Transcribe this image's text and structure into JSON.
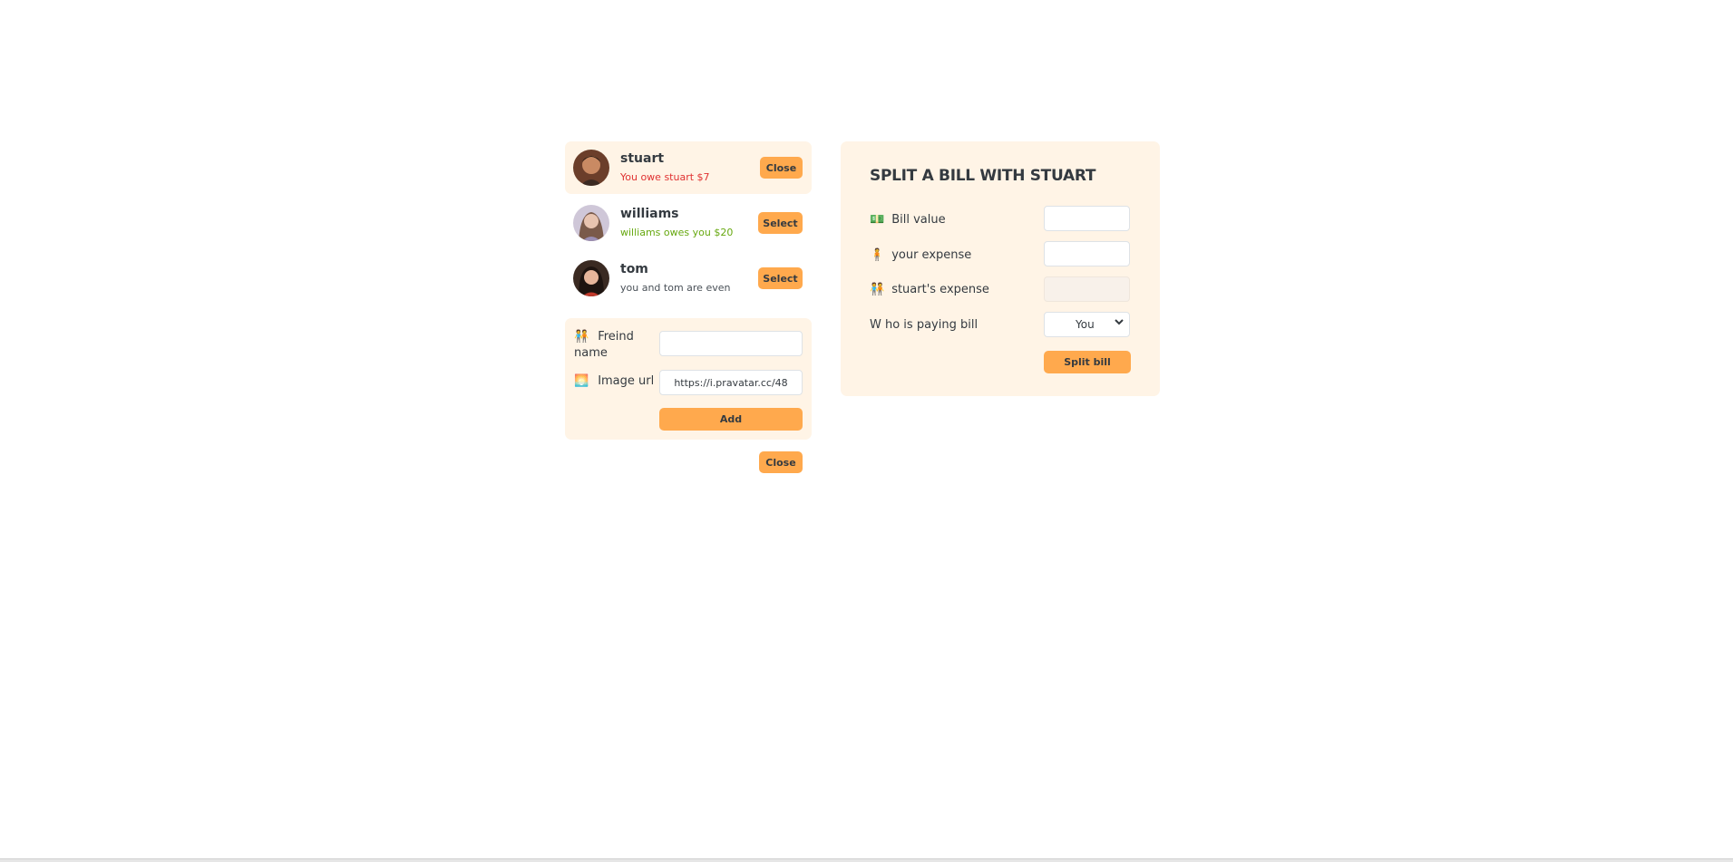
{
  "friends": [
    {
      "name": "stuart",
      "status": "You owe stuart $7",
      "status_tone": "red",
      "button": "Close",
      "selected": true
    },
    {
      "name": "williams",
      "status": "williams owes you $20",
      "status_tone": "green",
      "button": "Select",
      "selected": false
    },
    {
      "name": "tom",
      "status": "you and tom are even",
      "status_tone": "neutral",
      "button": "Select",
      "selected": false
    }
  ],
  "add_form": {
    "name_icon": "🧑‍🤝‍🧑",
    "name_label": "Freind name",
    "name_value": "",
    "image_icon": "🌅",
    "image_label": "Image url",
    "image_value": "https://i.pravatar.cc/48",
    "add_label": "Add"
  },
  "sidebar_close_label": "Close",
  "split": {
    "title": "SPLIT A BILL WITH STUART",
    "bill_icon": "💵",
    "bill_label": "Bill value",
    "bill_value": "",
    "your_icon": "🧍",
    "your_label": "your expense",
    "your_value": "",
    "friend_icon": "🧑‍🤝‍🧑",
    "friend_label": "stuart's expense",
    "friend_value": "",
    "payer_label": "W ho is paying bill",
    "payer_value": "You",
    "split_label": "Split bill"
  },
  "colors": {
    "accent": "#ffa94d",
    "panel": "#fff4e6",
    "owe": "#e03131",
    "owed": "#66a80f"
  }
}
